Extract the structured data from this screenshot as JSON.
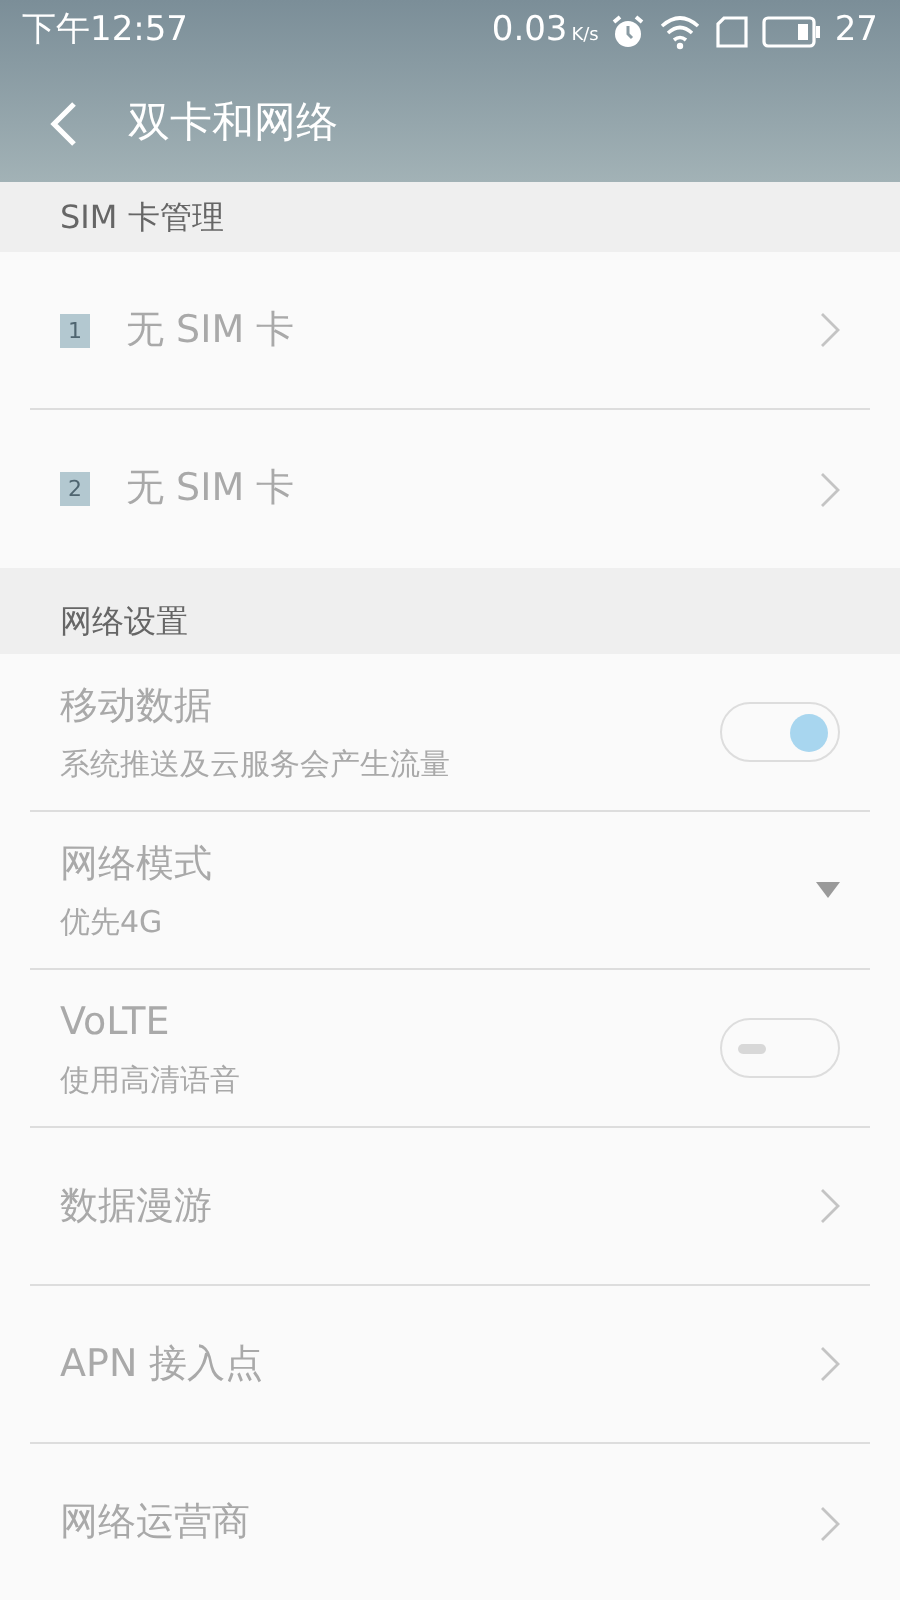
{
  "status_bar": {
    "time": "下午12:57",
    "speed": "0.03",
    "speed_unit": "K/s",
    "battery": "27"
  },
  "header": {
    "title": "双卡和网络"
  },
  "sections": [
    {
      "title": "SIM 卡管理",
      "rows": [
        {
          "kind": "sim",
          "badge": "1",
          "label": "无 SIM 卡"
        },
        {
          "kind": "sim",
          "badge": "2",
          "label": "无 SIM 卡"
        }
      ]
    },
    {
      "title": "网络设置",
      "rows": [
        {
          "kind": "toggle",
          "label": "移动数据",
          "subtitle": "系统推送及云服务会产生流量",
          "on": true
        },
        {
          "kind": "dropdown",
          "label": "网络模式",
          "subtitle": "优先4G"
        },
        {
          "kind": "toggle",
          "label": "VoLTE",
          "subtitle": "使用高清语音",
          "on": false
        },
        {
          "kind": "link",
          "label": "数据漫游"
        },
        {
          "kind": "link",
          "label": "APN 接入点"
        },
        {
          "kind": "link",
          "label": "网络运营商"
        }
      ]
    }
  ]
}
